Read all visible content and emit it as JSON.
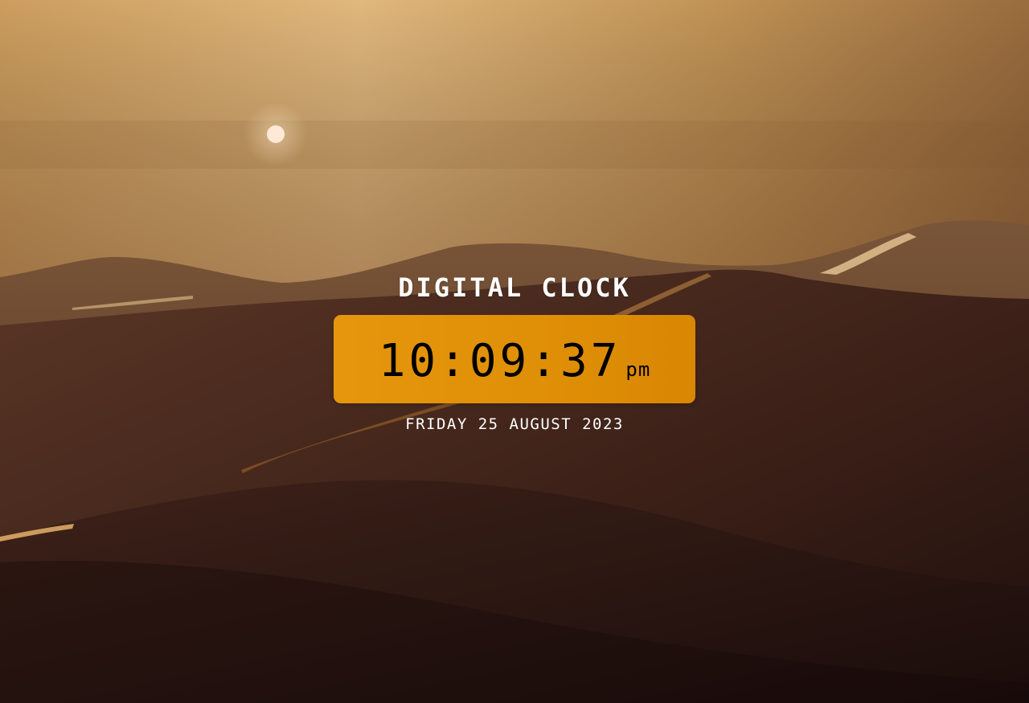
{
  "clock": {
    "title": "DIGITAL CLOCK",
    "time": "10:09:37",
    "ampm": "pm",
    "date": "FRIDAY 25 AUGUST 2023"
  },
  "colors": {
    "accent": "#e09006",
    "text": "#ffffff",
    "digits": "#000000",
    "sky": "#d9b277",
    "dunes": "#3a2018"
  },
  "background": {
    "scene": "desert-dunes-sunset"
  }
}
